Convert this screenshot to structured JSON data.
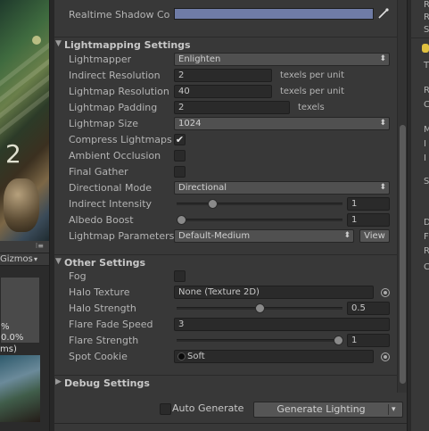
{
  "scene_view": {
    "overlay_digit": "2",
    "gizmos_label": "Gizmos",
    "stats_lines": [
      "%",
      "0.0%",
      "ms)"
    ]
  },
  "inspector": {
    "realtime_shadow": {
      "label": "Realtime Shadow Co",
      "color": "#6f7ca6"
    },
    "lightmapping": {
      "title": "Lightmapping Settings",
      "lightmapper": {
        "label": "Lightmapper",
        "value": "Enlighten"
      },
      "indirect_resolution": {
        "label": "Indirect Resolution",
        "value": "2",
        "unit": "texels per unit"
      },
      "lightmap_resolution": {
        "label": "Lightmap Resolution",
        "value": "40",
        "unit": "texels per unit"
      },
      "lightmap_padding": {
        "label": "Lightmap Padding",
        "value": "2",
        "unit": "texels"
      },
      "lightmap_size": {
        "label": "Lightmap Size",
        "value": "1024"
      },
      "compress_lightmaps": {
        "label": "Compress Lightmaps",
        "checked": true
      },
      "ambient_occlusion": {
        "label": "Ambient Occlusion",
        "checked": false
      },
      "final_gather": {
        "label": "Final Gather",
        "checked": false
      },
      "directional_mode": {
        "label": "Directional Mode",
        "value": "Directional"
      },
      "indirect_intensity": {
        "label": "Indirect Intensity",
        "value": "1",
        "slider_fraction": 0.2
      },
      "albedo_boost": {
        "label": "Albedo Boost",
        "value": "1",
        "slider_fraction": 0.0
      },
      "lightmap_parameters": {
        "label": "Lightmap Parameters",
        "value": "Default-Medium",
        "view_label": "View"
      }
    },
    "other": {
      "title": "Other Settings",
      "fog": {
        "label": "Fog",
        "checked": false
      },
      "halo_texture": {
        "label": "Halo Texture",
        "value": "None (Texture 2D)"
      },
      "halo_strength": {
        "label": "Halo Strength",
        "value": "0.5",
        "slider_fraction": 0.5
      },
      "flare_fade_speed": {
        "label": "Flare Fade Speed",
        "value": "3"
      },
      "flare_strength": {
        "label": "Flare Strength",
        "value": "1",
        "slider_fraction": 1.0
      },
      "spot_cookie": {
        "label": "Spot Cookie",
        "value": "Soft"
      }
    },
    "debug": {
      "title": "Debug Settings"
    },
    "footer": {
      "auto_generate_label": "Auto Generate",
      "auto_generate_checked": false,
      "generate_label": "Generate Lighting"
    }
  },
  "right_panel": {
    "letters": [
      "R",
      "R",
      "S",
      "T",
      "R",
      "C",
      "M",
      "I",
      "I",
      "S",
      "D",
      "F",
      "R",
      "C"
    ]
  }
}
